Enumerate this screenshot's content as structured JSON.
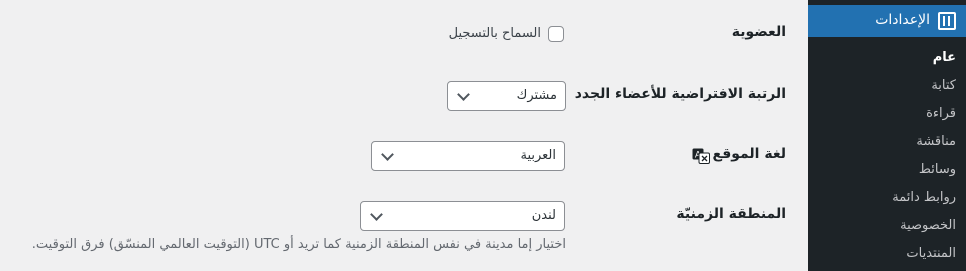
{
  "sidebar": {
    "menu_title": "الإعدادات",
    "menu_icon": "settings-icon",
    "items": [
      {
        "label": "عام",
        "current": true
      },
      {
        "label": "كتابة"
      },
      {
        "label": "قراءة"
      },
      {
        "label": "مناقشة"
      },
      {
        "label": "وسائط"
      },
      {
        "label": "روابط دائمة"
      },
      {
        "label": "الخصوصية"
      },
      {
        "label": "المنتديات"
      }
    ]
  },
  "settings": {
    "membership": {
      "label": "العضوية",
      "checkbox_label": "السماح بالتسجيل",
      "checked": false
    },
    "default_role": {
      "label": "الرتبة الافتراضية للأعضاء الجدد",
      "value": "مشترك"
    },
    "site_language": {
      "label": "لغة الموقع",
      "icon": "translate-icon",
      "value": "العربية"
    },
    "timezone": {
      "label": "المنطقة الزمنيّة",
      "value": "لندن",
      "description": "اختيار إما مدينة في نفس المنطقة الزمنية كما تريد أو UTC (التوقيت العالمي المنسّق) فرق التوقيت."
    }
  },
  "colors": {
    "accent": "#2271b1",
    "sidebar": "#1d2327",
    "background": "#f0f0f1"
  }
}
